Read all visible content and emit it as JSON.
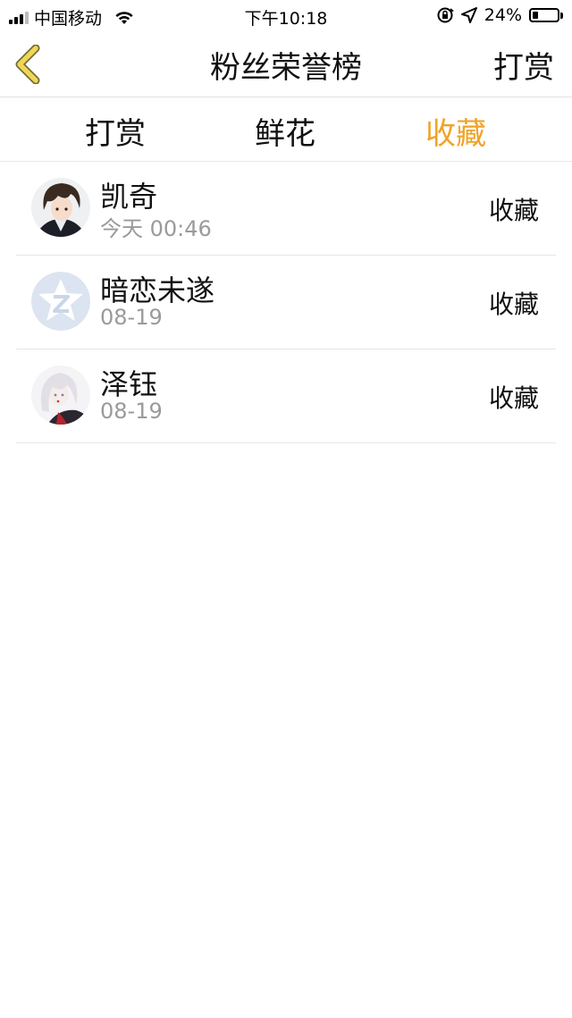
{
  "status_bar": {
    "carrier": "中国移动",
    "time": "下午10:18",
    "battery_percent": "24%",
    "battery_level": 0.24,
    "icons": [
      "signal-icon",
      "wifi-icon",
      "orientation-lock-icon",
      "location-arrow-icon",
      "battery-icon"
    ]
  },
  "header": {
    "back_icon": "chevron-left-icon",
    "title": "粉丝荣誉榜",
    "action_label": "打赏"
  },
  "tabs": [
    {
      "label": "打赏",
      "active": false
    },
    {
      "label": "鲜花",
      "active": false
    },
    {
      "label": "收藏",
      "active": true
    }
  ],
  "colors": {
    "accent": "#f0a326",
    "back_icon_fill": "#f2d553",
    "back_icon_stroke": "#6b6b3a",
    "muted_text": "#9a9a9a"
  },
  "list": [
    {
      "name": "凯奇",
      "time": "今天 00:46",
      "action": "收藏",
      "avatar": "anime-boy-avatar"
    },
    {
      "name": "暗恋未遂",
      "time": "08-19",
      "action": "收藏",
      "avatar": "default-star-avatar"
    },
    {
      "name": "泽钰",
      "time": "08-19",
      "action": "收藏",
      "avatar": "anime-white-hair-avatar"
    }
  ]
}
